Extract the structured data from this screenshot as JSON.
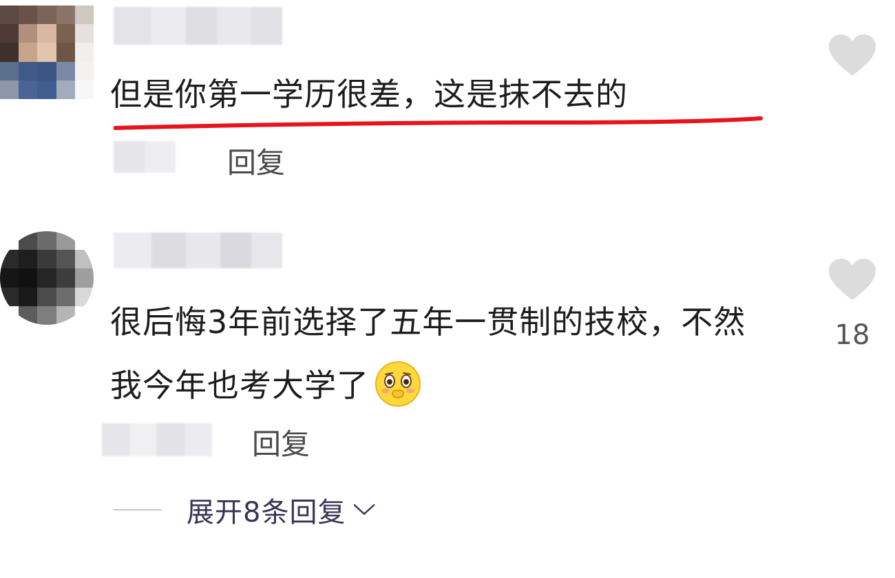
{
  "comments": [
    {
      "text": "但是你第一学历很差，这是抹不去的",
      "reply_label": "回复",
      "highlighted": true,
      "highlight_color": "#e8141c",
      "likes": ""
    },
    {
      "text": "很后悔3年前选择了五年一贯制的技校，不然我今年也考大学了",
      "reply_label": "回复",
      "emoji": "shy-blush-emoji",
      "likes": "18"
    }
  ],
  "expand_replies": {
    "label": "展开8条回复",
    "icon": "chevron-down-icon"
  },
  "icons": {
    "like": "heart-icon"
  },
  "colors": {
    "text": "#1c1c1c",
    "reply": "#4a4a4a",
    "heart": "#dcdcdc",
    "expand": "#3a3355"
  }
}
